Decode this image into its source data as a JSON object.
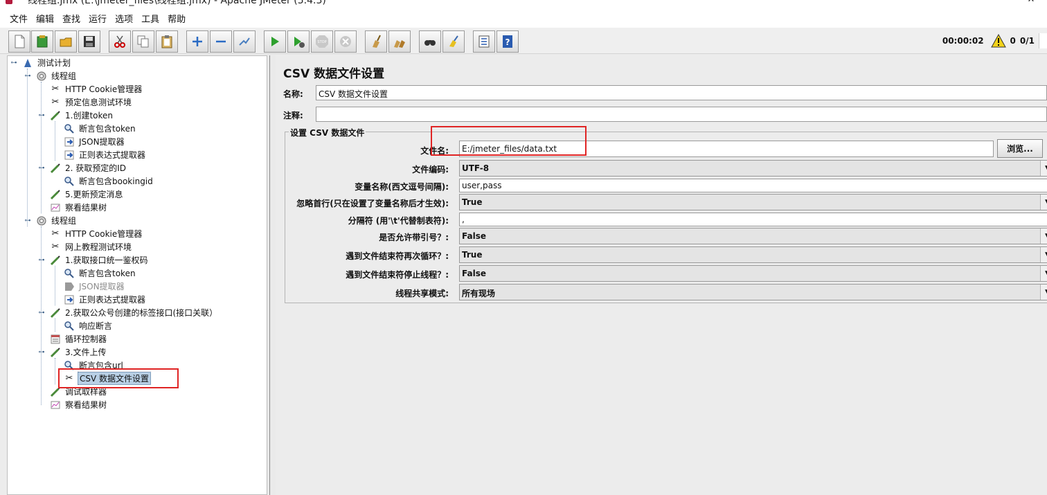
{
  "window": {
    "title": "线程组.jmx (E:\\jmeter_files\\线程组.jmx) - Apache JMeter (5.4.3)",
    "minimize": "—",
    "close": "✕"
  },
  "menu": [
    "文件",
    "编辑",
    "查找",
    "运行",
    "选项",
    "工具",
    "帮助"
  ],
  "toolbar": {
    "icons": [
      "new-icon",
      "templates-icon",
      "open-icon",
      "save-icon",
      "cut-icon",
      "copy-icon",
      "paste-icon",
      "expand-icon",
      "collapse-icon",
      "toggle-icon",
      "start-icon",
      "start-no-pause-icon",
      "stop-icon",
      "shutdown-icon",
      "clear-icon",
      "clear-all-icon",
      "search-icon",
      "reset-search-icon",
      "function-helper-icon",
      "help-icon"
    ],
    "elapsed": "00:00:02",
    "warnings": "0",
    "threads": "0/1"
  },
  "tree": [
    {
      "label": "测试计划",
      "icon": "test-plan-icon"
    },
    {
      "label": "线程组",
      "icon": "thread-group-icon"
    },
    {
      "label": "HTTP Cookie管理器",
      "icon": "config-tools-icon"
    },
    {
      "label": "预定信息测试环境",
      "icon": "config-tools-icon"
    },
    {
      "label": "1.创建token",
      "icon": "sampler-icon"
    },
    {
      "label": "断言包含token",
      "icon": "assertion-icon"
    },
    {
      "label": "JSON提取器",
      "icon": "extractor-icon"
    },
    {
      "label": "正则表达式提取器",
      "icon": "extractor-icon"
    },
    {
      "label": "2. 获取预定的ID",
      "icon": "sampler-icon"
    },
    {
      "label": "断言包含bookingid",
      "icon": "assertion-icon"
    },
    {
      "label": "5.更新预定消息",
      "icon": "sampler-icon"
    },
    {
      "label": "察看结果树",
      "icon": "listener-icon"
    },
    {
      "label": "线程组",
      "icon": "thread-group-icon"
    },
    {
      "label": "HTTP Cookie管理器",
      "icon": "config-tools-icon"
    },
    {
      "label": "网上教程测试环境",
      "icon": "config-tools-icon"
    },
    {
      "label": "1.获取接口统一鉴权码",
      "icon": "sampler-icon"
    },
    {
      "label": "断言包含token",
      "icon": "assertion-icon"
    },
    {
      "label": "JSON提取器",
      "icon": "extractor-disabled-icon"
    },
    {
      "label": "正则表达式提取器",
      "icon": "extractor-icon"
    },
    {
      "label": "2.获取公众号创建的标签接口(接口关联）",
      "icon": "sampler-icon"
    },
    {
      "label": "响应断言",
      "icon": "assertion-icon"
    },
    {
      "label": "循环控制器",
      "icon": "loop-controller-icon"
    },
    {
      "label": "3.文件上传",
      "icon": "sampler-icon"
    },
    {
      "label": "断言包含url",
      "icon": "assertion-icon"
    },
    {
      "label": "CSV 数据文件设置",
      "icon": "config-tools-icon"
    },
    {
      "label": "调试取样器",
      "icon": "sampler-icon"
    },
    {
      "label": "察看结果树",
      "icon": "listener-icon"
    }
  ],
  "content": {
    "title": "CSV 数据文件设置",
    "name_label": "名称:",
    "name_value": "CSV 数据文件设置",
    "comment_label": "注释:",
    "comment_value": "",
    "group_title": "设置 CSV 数据文件",
    "filename_label": "文件名:",
    "filename_value": "E:/jmeter_files/data.txt",
    "browse": "浏览...",
    "encoding_label": "文件编码:",
    "encoding_value": "UTF-8",
    "varnames_label": "变量名称(西文逗号间隔):",
    "varnames_value": "user,pass",
    "ignore_first_label": "忽略首行(只在设置了变量名称后才生效):",
    "ignore_first_value": "True",
    "delimiter_label": "分隔符 (用'\\t'代替制表符):",
    "delimiter_value": ",",
    "quoted_label": "是否允许带引号？:",
    "quoted_value": "False",
    "recycle_label": "遇到文件结束符再次循环？:",
    "recycle_value": "True",
    "stop_label": "遇到文件结束符停止线程？:",
    "stop_value": "False",
    "sharing_label": "线程共享模式:",
    "sharing_value": "所有现场"
  }
}
